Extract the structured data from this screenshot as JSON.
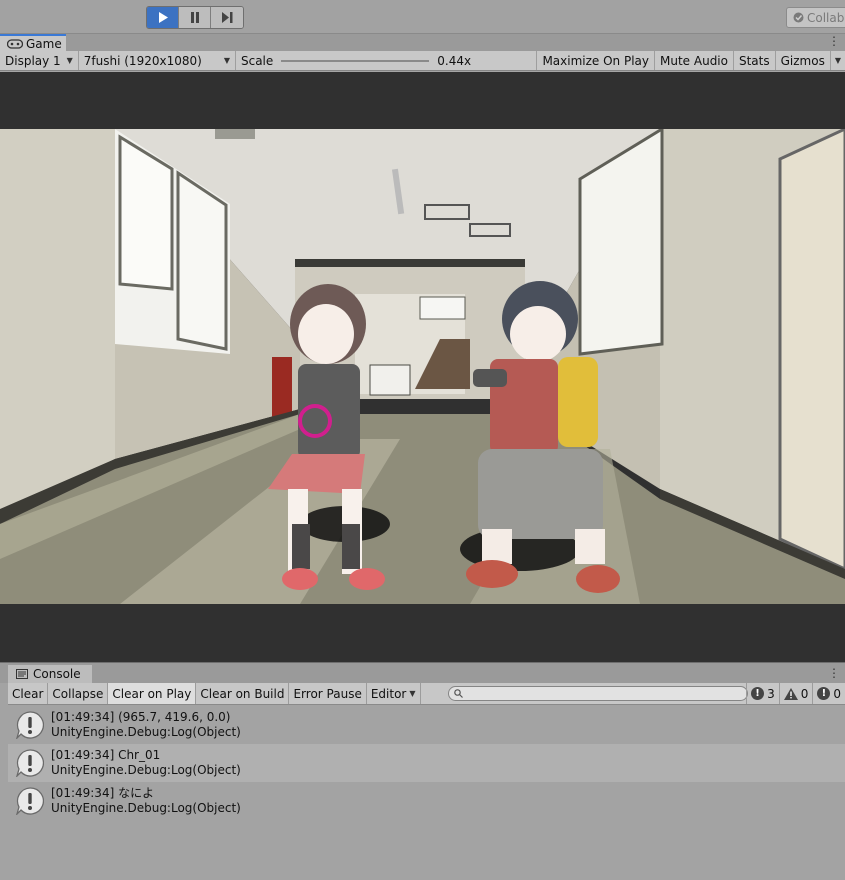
{
  "toolbar": {
    "play_state": "playing",
    "collab_label": "Collab"
  },
  "game_tab": {
    "label": "Game"
  },
  "game_toolbar": {
    "display": "Display 1",
    "resolution": "7fushi (1920x1080)",
    "scale_label": "Scale",
    "scale_value": "0.44x",
    "maximize": "Maximize On Play",
    "mute": "Mute Audio",
    "stats": "Stats",
    "gizmos": "Gizmos"
  },
  "console_tab": {
    "label": "Console"
  },
  "console_toolbar": {
    "clear": "Clear",
    "collapse": "Collapse",
    "clear_on_play": "Clear on Play",
    "clear_on_build": "Clear on Build",
    "error_pause": "Error Pause",
    "editor": "Editor",
    "search_placeholder": "",
    "log_count": "3",
    "warning_count": "0",
    "error_count": "0"
  },
  "logs": [
    {
      "message": "[01:49:34] (965.7, 419.6, 0.0)",
      "trace": "UnityEngine.Debug:Log(Object)"
    },
    {
      "message": "[01:49:34] Chr_01",
      "trace": "UnityEngine.Debug:Log(Object)"
    },
    {
      "message": "[01:49:34] なによ",
      "trace": "UnityEngine.Debug:Log(Object)"
    }
  ],
  "colors": {
    "play_active": "#3c72c2",
    "tab_accent": "#3a79d6",
    "viewport_bg": "#303030"
  }
}
